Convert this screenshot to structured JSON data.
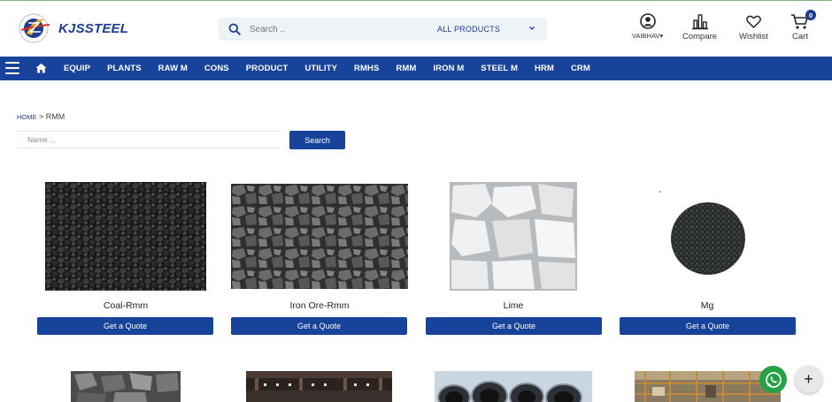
{
  "brand": {
    "name": "KJSSTEEL",
    "accent": "#1b3d8f",
    "nav_bg": "#17439a"
  },
  "search": {
    "placeholder": "Search ..",
    "category": "ALL PRODUCTS"
  },
  "header_icons": {
    "user": "VAIBHAV",
    "compare": "Compare",
    "wishlist": "Wishlist",
    "cart": "Cart",
    "cart_count": "0"
  },
  "nav": {
    "items": [
      "EQUIP",
      "PLANTS",
      "RAW M",
      "CONS",
      "PRODUCT",
      "UTILITY",
      "RMHS",
      "RMM",
      "IRON M",
      "STEEL M",
      "HRM",
      "CRM"
    ]
  },
  "breadcrumb": {
    "home": "HOME",
    "separator": " > ",
    "current": "RMM"
  },
  "filter": {
    "name_placeholder": "Name ...",
    "search_label": "Search"
  },
  "products": [
    {
      "name": "Coal-Rmm",
      "quote": "Get a Quote"
    },
    {
      "name": "Iron Ore-Rmm",
      "quote": "Get a Quote"
    },
    {
      "name": "Lime",
      "quote": "Get a Quote"
    },
    {
      "name": "Mg",
      "quote": "Get a Quote"
    }
  ],
  "fab": {
    "plus": "+"
  }
}
